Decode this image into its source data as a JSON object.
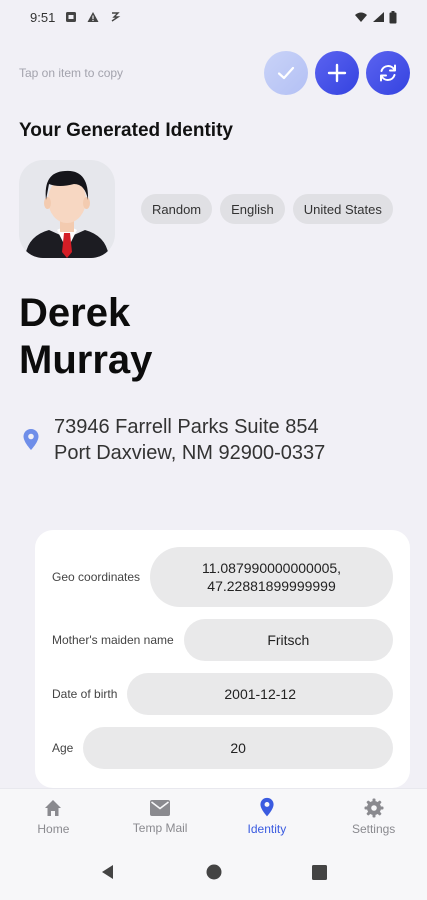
{
  "status_bar": {
    "time": "9:51"
  },
  "header": {
    "hint": "Tap on item to copy",
    "actions": [
      {
        "name": "check-button",
        "icon": "check-icon",
        "enabled": false
      },
      {
        "name": "add-button",
        "icon": "plus-icon",
        "enabled": true
      },
      {
        "name": "refresh-button",
        "icon": "refresh-icon",
        "enabled": true
      }
    ]
  },
  "identity": {
    "section_title": "Your Generated Identity",
    "chips": [
      "Random",
      "English",
      "United States"
    ],
    "first_name": "Derek",
    "last_name": "Murray",
    "address_line1": "73946 Farrell Parks Suite 854",
    "address_line2": "Port Daxview, NM 92900-0337"
  },
  "details": {
    "geo": {
      "label": "Geo coordinates",
      "line1": "11.087990000000005,",
      "line2": "47.22881899999999"
    },
    "maiden": {
      "label": "Mother's maiden name",
      "value": "Fritsch"
    },
    "dob": {
      "label": "Date of birth",
      "value": "2001-12-12"
    },
    "age": {
      "label": "Age",
      "value": "20"
    }
  },
  "nav": {
    "items": [
      {
        "label": "Home",
        "icon": "home-icon"
      },
      {
        "label": "Temp Mail",
        "icon": "mail-icon"
      },
      {
        "label": "Identity",
        "icon": "location-pin-icon"
      },
      {
        "label": "Settings",
        "icon": "gear-icon"
      }
    ],
    "active": "Identity"
  },
  "colors": {
    "accent": "#3a5be0",
    "background": "#f1f0f6",
    "card": "#ffffff"
  }
}
